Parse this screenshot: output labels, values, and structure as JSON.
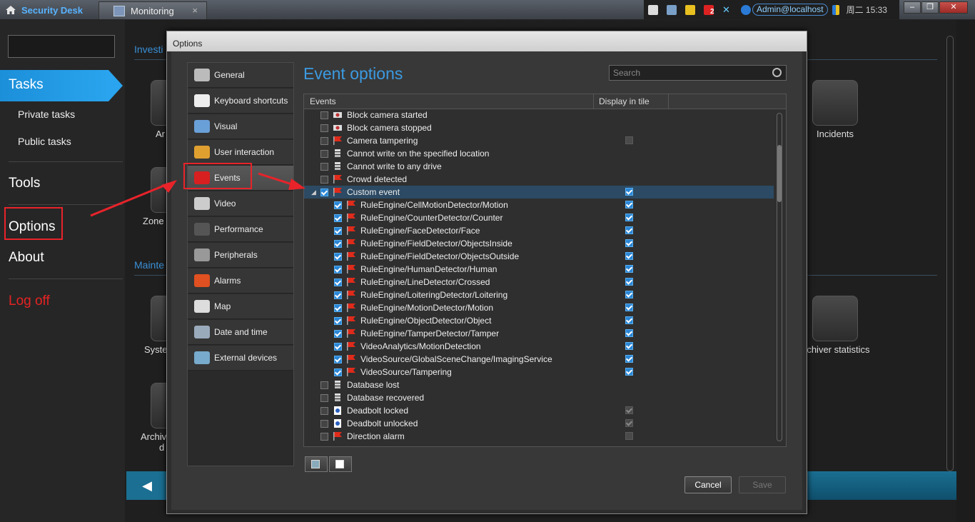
{
  "app": {
    "title": "Security Desk",
    "tab": "Monitoring",
    "tab_close": "×",
    "user": "Admin@localhost",
    "notif_count": "2",
    "clock": "周二 15:33",
    "win_min": "–",
    "win_restore": "❐",
    "win_close": "✕"
  },
  "sidebar": {
    "tasks": "Tasks",
    "private_tasks": "Private tasks",
    "public_tasks": "Public tasks",
    "tools": "Tools",
    "options": "Options",
    "about": "About",
    "logoff": "Log off"
  },
  "background": {
    "section_investigation": "Investi",
    "section_maintenance": "Mainte",
    "tiles": [
      "Ar",
      "Zone",
      "Syste",
      "Archiv",
      "d",
      "Incidents",
      "rchiver statistics"
    ],
    "back": "◀"
  },
  "dialog": {
    "title": "Options",
    "heading": "Event options",
    "search_placeholder": "Search",
    "col_events": "Events",
    "col_display": "Display in tile",
    "cancel": "Cancel",
    "save": "Save",
    "categories": [
      "General",
      "Keyboard shortcuts",
      "Visual",
      "User interaction",
      "Events",
      "Video",
      "Performance",
      "Peripherals",
      "Alarms",
      "Map",
      "Date and time",
      "External devices"
    ],
    "events": [
      {
        "label": "Block camera started",
        "checked": false,
        "display": null,
        "indent": 0,
        "icon": "camera-block-icon"
      },
      {
        "label": "Block camera stopped",
        "checked": false,
        "display": null,
        "indent": 0,
        "icon": "camera-block-icon"
      },
      {
        "label": "Camera tampering",
        "checked": false,
        "display": "off-dim",
        "indent": 0,
        "icon": "flag-icon"
      },
      {
        "label": "Cannot write on the specified location",
        "checked": false,
        "display": null,
        "indent": 0,
        "icon": "server-icon"
      },
      {
        "label": "Cannot write to any drive",
        "checked": false,
        "display": null,
        "indent": 0,
        "icon": "server-icon"
      },
      {
        "label": "Crowd detected",
        "checked": false,
        "display": null,
        "indent": 0,
        "icon": "flag-icon"
      },
      {
        "label": "Custom event",
        "checked": true,
        "display": "on",
        "indent": 0,
        "icon": "flag-icon",
        "expanded": true,
        "selected": true
      },
      {
        "label": "RuleEngine/CellMotionDetector/Motion",
        "checked": true,
        "display": "on",
        "indent": 1,
        "icon": "flag-icon"
      },
      {
        "label": "RuleEngine/CounterDetector/Counter",
        "checked": true,
        "display": "on",
        "indent": 1,
        "icon": "flag-icon"
      },
      {
        "label": "RuleEngine/FaceDetector/Face",
        "checked": true,
        "display": "on",
        "indent": 1,
        "icon": "flag-icon"
      },
      {
        "label": "RuleEngine/FieldDetector/ObjectsInside",
        "checked": true,
        "display": "on",
        "indent": 1,
        "icon": "flag-icon"
      },
      {
        "label": "RuleEngine/FieldDetector/ObjectsOutside",
        "checked": true,
        "display": "on",
        "indent": 1,
        "icon": "flag-icon"
      },
      {
        "label": "RuleEngine/HumanDetector/Human",
        "checked": true,
        "display": "on",
        "indent": 1,
        "icon": "flag-icon"
      },
      {
        "label": "RuleEngine/LineDetector/Crossed",
        "checked": true,
        "display": "on",
        "indent": 1,
        "icon": "flag-icon"
      },
      {
        "label": "RuleEngine/LoiteringDetector/Loitering",
        "checked": true,
        "display": "on",
        "indent": 1,
        "icon": "flag-icon"
      },
      {
        "label": "RuleEngine/MotionDetector/Motion",
        "checked": true,
        "display": "on",
        "indent": 1,
        "icon": "flag-icon"
      },
      {
        "label": "RuleEngine/ObjectDetector/Object",
        "checked": true,
        "display": "on",
        "indent": 1,
        "icon": "flag-icon"
      },
      {
        "label": "RuleEngine/TamperDetector/Tamper",
        "checked": true,
        "display": "on",
        "indent": 1,
        "icon": "flag-icon"
      },
      {
        "label": "VideoAnalytics/MotionDetection",
        "checked": true,
        "display": "on",
        "indent": 1,
        "icon": "flag-icon"
      },
      {
        "label": "VideoSource/GlobalSceneChange/ImagingService",
        "checked": true,
        "display": "on",
        "indent": 1,
        "icon": "flag-icon"
      },
      {
        "label": "VideoSource/Tampering",
        "checked": true,
        "display": "on",
        "indent": 1,
        "icon": "flag-icon"
      },
      {
        "label": "Database lost",
        "checked": false,
        "display": null,
        "indent": 0,
        "icon": "server-icon"
      },
      {
        "label": "Database recovered",
        "checked": false,
        "display": null,
        "indent": 0,
        "icon": "server-icon"
      },
      {
        "label": "Deadbolt locked",
        "checked": false,
        "display": "on-dim",
        "indent": 0,
        "icon": "lock-icon"
      },
      {
        "label": "Deadbolt unlocked",
        "checked": false,
        "display": "on-dim",
        "indent": 0,
        "icon": "lock-icon"
      },
      {
        "label": "Direction alarm",
        "checked": false,
        "display": "off-dim",
        "indent": 0,
        "icon": "flag-icon"
      }
    ]
  },
  "colors": {
    "accent": "#3c9ae0",
    "tasks_bg": "#1c8fd9",
    "logoff": "#e62323",
    "highlight": "#e8232a"
  }
}
